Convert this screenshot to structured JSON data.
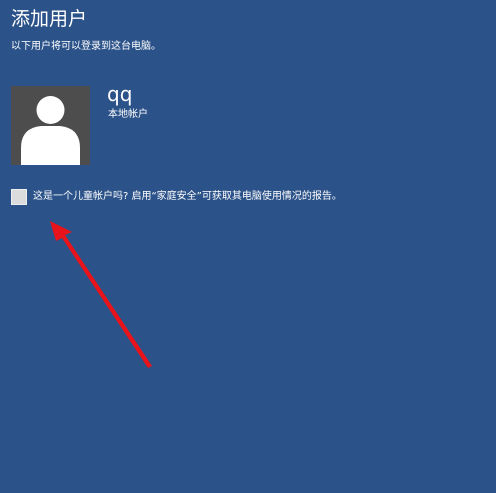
{
  "header": {
    "title": "添加用户",
    "subtitle": "以下用户将可以登录到这台电脑。"
  },
  "user": {
    "name": "qq",
    "account_type": "本地帐户",
    "avatar_icon": "user-silhouette-icon"
  },
  "child_account": {
    "checked": false,
    "label": "这是一个儿童帐户吗? 启用“家庭安全”可获取其电脑使用情况的报告。"
  },
  "annotation": {
    "arrow_color": "#e8141b"
  },
  "colors": {
    "background": "#2b5289",
    "avatar_bg": "#4d4d4d",
    "text": "#ffffff"
  }
}
